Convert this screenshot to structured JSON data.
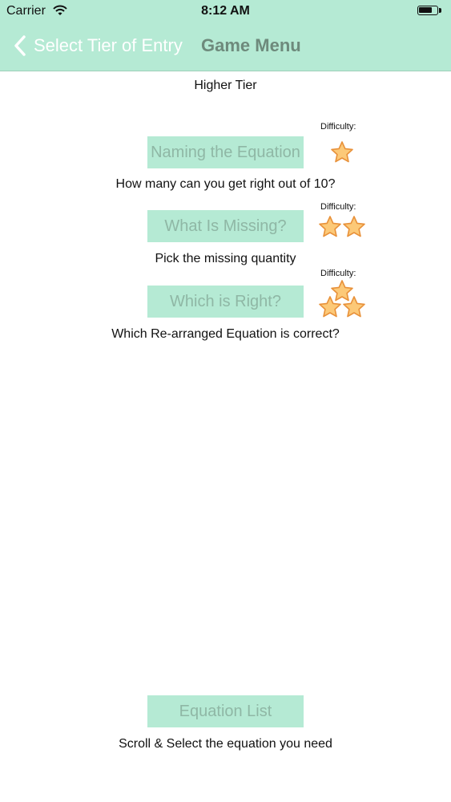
{
  "status_bar": {
    "carrier": "Carrier",
    "time": "8:12 AM",
    "battery_level": 0.75
  },
  "nav": {
    "back_label": "Select Tier of Entry",
    "title": "Game Menu"
  },
  "section": {
    "heading": "Higher Tier"
  },
  "games": [
    {
      "label": "Naming the Equation",
      "difficulty_label": "Difficulty:",
      "stars": 1,
      "description": "How many can you get right out of 10?"
    },
    {
      "label": "What Is Missing?",
      "difficulty_label": "Difficulty:",
      "stars": 2,
      "description": "Pick the missing quantity"
    },
    {
      "label": "Which is Right?",
      "difficulty_label": "Difficulty:",
      "stars": 3,
      "description": "Which Re-arranged Equation is correct?"
    }
  ],
  "equation_list": {
    "label": "Equation List",
    "description": "Scroll & Select the equation you need"
  },
  "colors": {
    "nav_background": "#b5ead4",
    "button_background": "#b5ead4",
    "button_text": "#8fb7a5",
    "title_text": "#6e8a7c",
    "star_fill": "#fcc978",
    "star_stroke": "#e8913a"
  }
}
